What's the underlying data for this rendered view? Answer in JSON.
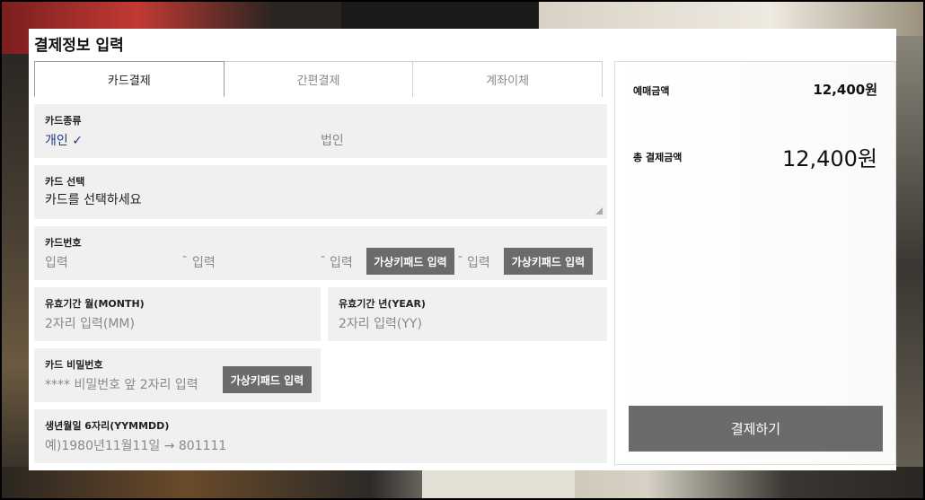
{
  "title": "결제정보 입력",
  "tabs": [
    {
      "label": "카드결제"
    },
    {
      "label": "간편결제"
    },
    {
      "label": "계좌이체"
    }
  ],
  "card_type": {
    "label": "카드종류",
    "personal": "개인",
    "personal_check": "✓",
    "corporate": "법인"
  },
  "card_select": {
    "label": "카드 선택",
    "value": "카드를 선택하세요"
  },
  "card_number": {
    "label": "카드번호",
    "placeholder": "입력",
    "separator": "-",
    "keypad_label": "가상키패드 입력"
  },
  "expiry_month": {
    "label": "유효기간 월(MONTH)",
    "placeholder": "2자리 입력(MM)"
  },
  "expiry_year": {
    "label": "유효기간 년(YEAR)",
    "placeholder": "2자리 입력(YY)"
  },
  "password": {
    "label": "카드 비밀번호",
    "placeholder": "**** 비밀번호 앞 2자리 입력",
    "keypad_label": "가상키패드 입력"
  },
  "birth": {
    "label": "생년월일 6자리(YYMMDD)",
    "placeholder": "예)1980년11월11일 → 801111"
  },
  "summary": {
    "booking_label": "예매금액",
    "booking_value": "12,400원",
    "total_label": "총 결제금액",
    "total_value": "12,400원",
    "pay_button": "결제하기"
  },
  "colors": {
    "button_gray": "#6b6b6b",
    "field_bg": "#f0f0f0",
    "selected_blue": "#1e3a80"
  }
}
